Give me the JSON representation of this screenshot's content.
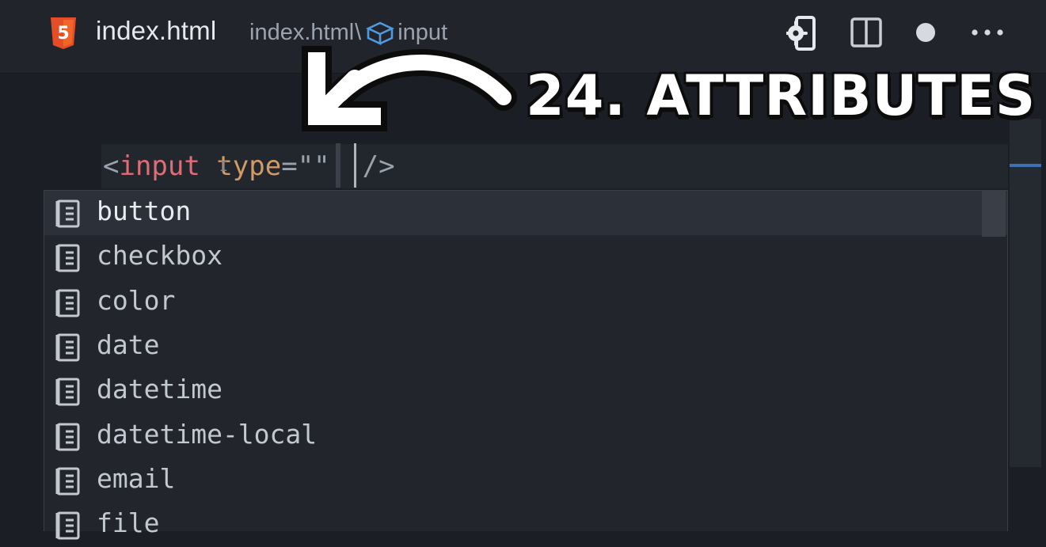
{
  "titlebar": {
    "file_name": "index.html",
    "breadcrumb": {
      "file": "index.html",
      "separator": "\\",
      "symbol": "input"
    },
    "icons": [
      "html5-icon",
      "open-preview-settings-icon",
      "split-editor-icon",
      "unsaved-dot-icon",
      "more-actions-icon"
    ]
  },
  "code": {
    "open_bracket": "<",
    "tag": "input",
    "attr": "type",
    "equals": "=",
    "value": "\"\"",
    "close": "/>"
  },
  "suggestions": {
    "items": [
      {
        "label": "button"
      },
      {
        "label": "checkbox"
      },
      {
        "label": "color"
      },
      {
        "label": "date"
      },
      {
        "label": "datetime"
      },
      {
        "label": "datetime-local"
      },
      {
        "label": "email"
      },
      {
        "label": "file"
      }
    ],
    "selected_index": 0,
    "item_icon": "value-enum-icon"
  },
  "overlay": {
    "title": "24. ATTRIBUTES"
  },
  "colors": {
    "background": "#1b1f25",
    "tag": "#e06c75",
    "attribute": "#d19a66",
    "html5": "#e44d26",
    "accent": "#3d6fb3"
  }
}
